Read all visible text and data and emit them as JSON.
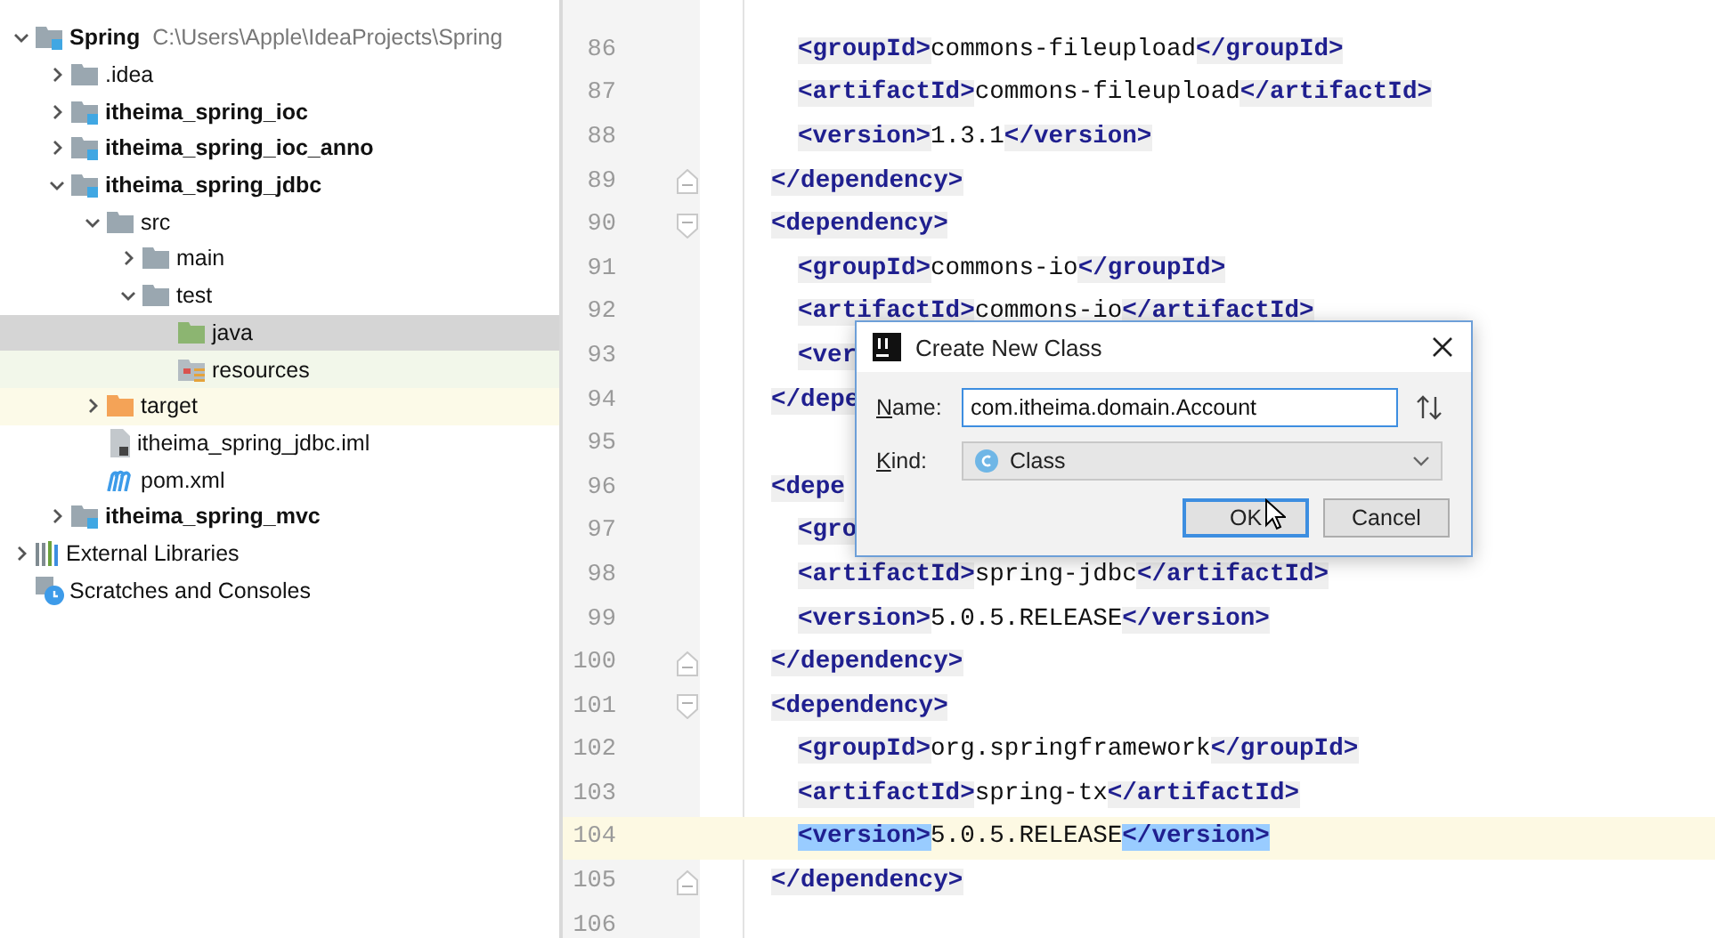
{
  "project_tree": [
    {
      "label": "Spring",
      "detail": "C:\\Users\\Apple\\IdeaProjects\\Spring",
      "kind": "module",
      "expanded": true,
      "selected": false,
      "children": [
        {
          "label": ".idea",
          "kind": "folder",
          "expanded": false,
          "selected": false
        },
        {
          "label": "itheima_spring_ioc",
          "kind": "module",
          "expanded": false,
          "selected": false
        },
        {
          "label": "itheima_spring_ioc_anno",
          "kind": "module",
          "expanded": false,
          "selected": false
        },
        {
          "label": "itheima_spring_jdbc",
          "kind": "module",
          "expanded": true,
          "selected": false,
          "children": [
            {
              "label": "src",
              "kind": "folder",
              "expanded": true,
              "selected": false,
              "children": [
                {
                  "label": "main",
                  "kind": "folder",
                  "expanded": false,
                  "selected": false
                },
                {
                  "label": "test",
                  "kind": "folder",
                  "expanded": true,
                  "selected": false,
                  "children": [
                    {
                      "label": "java",
                      "kind": "test-source",
                      "selected": true
                    },
                    {
                      "label": "resources",
                      "kind": "test-resources",
                      "selected": false
                    }
                  ]
                }
              ]
            },
            {
              "label": "target",
              "kind": "excluded",
              "expanded": false,
              "selected": false
            },
            {
              "label": "itheima_spring_jdbc.iml",
              "kind": "iml",
              "selected": false
            },
            {
              "label": "pom.xml",
              "kind": "maven",
              "selected": false
            }
          ]
        },
        {
          "label": "itheima_spring_mvc",
          "kind": "module",
          "expanded": false,
          "selected": false
        }
      ]
    },
    {
      "label": "External Libraries",
      "kind": "libraries",
      "expanded": false,
      "selected": false
    },
    {
      "label": "Scratches and Consoles",
      "kind": "scratches",
      "selected": false
    }
  ],
  "editor": {
    "lines": [
      {
        "number": "86",
        "kind": "inner",
        "open": "<groupId>",
        "value": "commons-fileupload",
        "close": "</groupId>",
        "current": false
      },
      {
        "number": "87",
        "kind": "inner",
        "open": "<artifactId>",
        "value": "commons-fileupload",
        "close": "</artifactId>",
        "current": false
      },
      {
        "number": "88",
        "kind": "inner",
        "open": "<version>",
        "value": "1.3.1",
        "close": "</version>",
        "current": false
      },
      {
        "number": "89",
        "kind": "outer",
        "open": "</dependency>",
        "fold_end": true,
        "current": false
      },
      {
        "number": "90",
        "kind": "outer",
        "open": "<dependency>",
        "fold_start": true,
        "current": false
      },
      {
        "number": "91",
        "kind": "inner",
        "open": "<groupId>",
        "value": "commons-io",
        "close": "</groupId>",
        "current": false
      },
      {
        "number": "92",
        "kind": "inner",
        "open": "<artifactId>",
        "value": "commons-io",
        "close": "</artifactId>",
        "current": false
      },
      {
        "number": "93",
        "kind": "inner",
        "open": "<ver",
        "current": false
      },
      {
        "number": "94",
        "kind": "outer",
        "open": "</depe",
        "current": false
      },
      {
        "number": "95",
        "kind": "blank",
        "current": false
      },
      {
        "number": "96",
        "kind": "outer",
        "open": "<depe",
        "current": false
      },
      {
        "number": "97",
        "kind": "inner",
        "open": "<gro",
        "current": false
      },
      {
        "number": "98",
        "kind": "inner",
        "open": "<artifactId>",
        "value": "spring-jdbc",
        "close": "</artifactId>",
        "current": false
      },
      {
        "number": "99",
        "kind": "inner",
        "open": "<version>",
        "value": "5.0.5.RELEASE",
        "close": "</version>",
        "current": false
      },
      {
        "number": "100",
        "kind": "outer",
        "open": "</dependency>",
        "fold_end": true,
        "current": false
      },
      {
        "number": "101",
        "kind": "outer",
        "open": "<dependency>",
        "fold_start": true,
        "current": false
      },
      {
        "number": "102",
        "kind": "inner",
        "open": "<groupId>",
        "value": "org.springframework",
        "close": "</groupId>",
        "current": false
      },
      {
        "number": "103",
        "kind": "inner",
        "open": "<artifactId>",
        "value": "spring-tx",
        "close": "</artifactId>",
        "current": false
      },
      {
        "number": "104",
        "kind": "inner",
        "open": "<version>",
        "value": "5.0.5.RELEASE",
        "close": "</version>",
        "current": true
      },
      {
        "number": "105",
        "kind": "outer",
        "open": "</dependency>",
        "fold_end": true,
        "current": false
      },
      {
        "number": "106",
        "kind": "blank",
        "current": false
      }
    ]
  },
  "dialog": {
    "title": "Create New Class",
    "name_label": "Name:",
    "name_value": "com.itheima.domain.Account",
    "kind_label": "Kind:",
    "kind_value": "Class",
    "buttons": [
      {
        "label": "OK",
        "default": true
      },
      {
        "label": "Cancel",
        "default": false
      }
    ]
  }
}
